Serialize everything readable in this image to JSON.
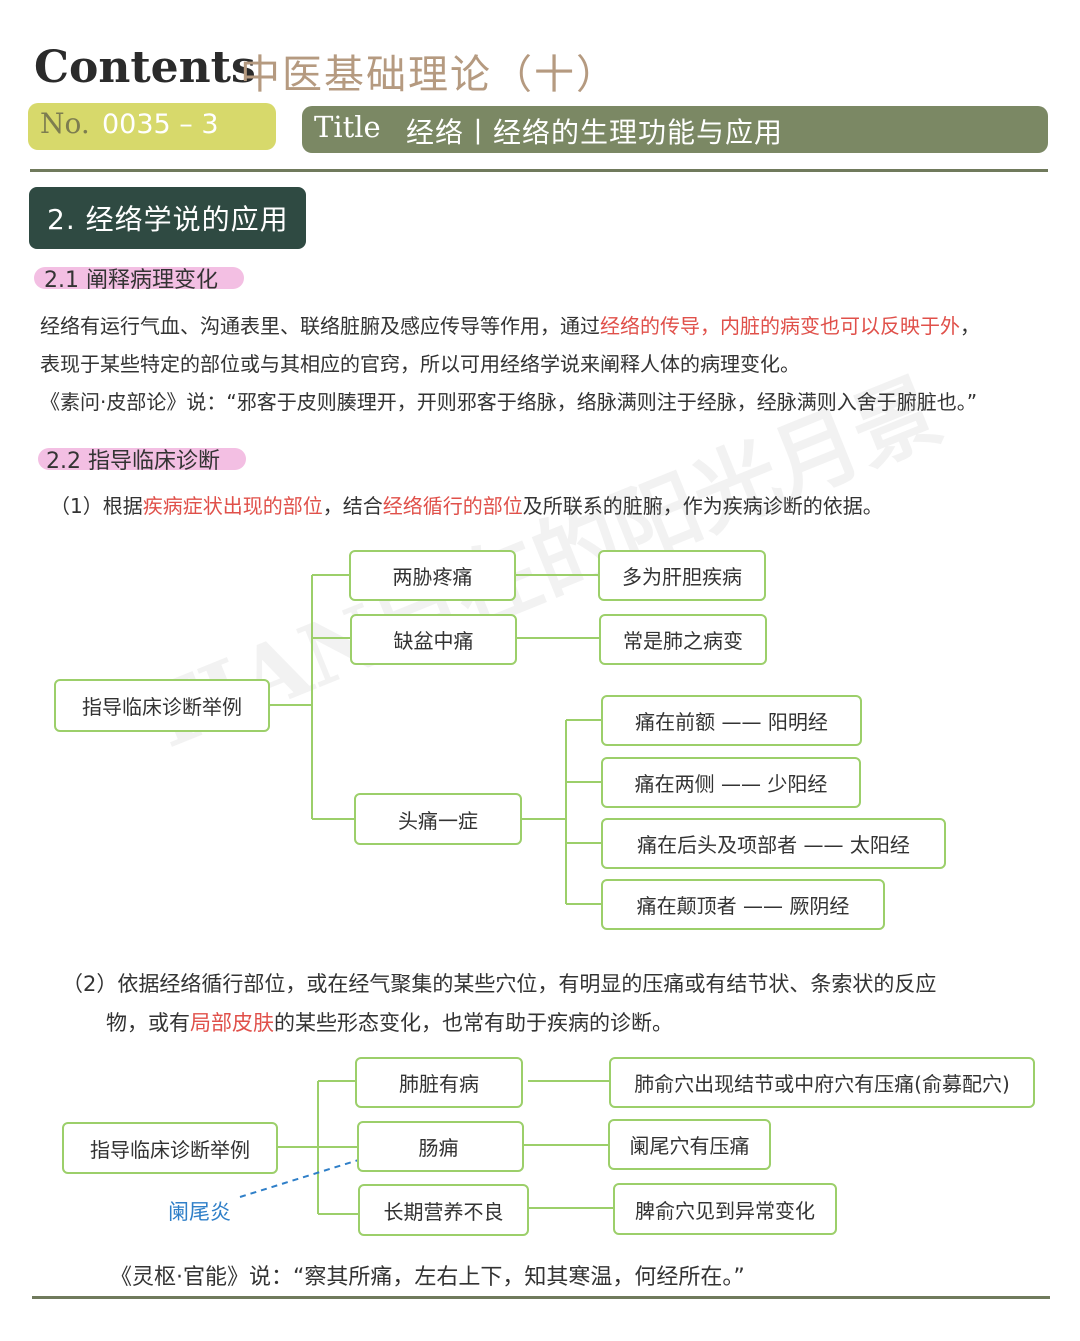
{
  "header": {
    "contents": "Contents",
    "subject": "中医基础理论（十）",
    "no_label": "No.",
    "no_value": "0035 – 3",
    "title_label": "Title",
    "title_text": "经络丨经络的生理功能与应用"
  },
  "section": {
    "title": "2.  经络学说的应用"
  },
  "sub1": {
    "title": "2.1  阐释病理变化",
    "line1_a": "经络有运行气血、沟通表里、联络脏腑及感应传导等作用，通过",
    "line1_red": "经络的传导，内脏的病变也可以反映于外",
    "line1_b": "，",
    "line2": "表现于某些特定的部位或与其相应的官窍，所以可用经络学说来阐释人体的病理变化。",
    "line3": "《素问·皮部论》说：“邪客于皮则腠理开，开则邪客于络脉，络脉满则注于经脉，经脉满则入舍于腑脏也。”"
  },
  "sub2": {
    "title": "2.2  指导临床诊断",
    "p1_a": "（1）根据",
    "p1_red1": "疾病症状出现的部位",
    "p1_b": "，结合",
    "p1_red2": "经络循行的部位",
    "p1_c": "及所联系的脏腑，作为疾病诊断的依据。",
    "p2_line1": "（2）依据经络循行部位，或在经气聚集的某些穴位，有明显的压痛或有结节状、条索状的反应",
    "p2_a": "物，或有",
    "p2_red": "局部皮肤",
    "p2_b": "的某些形态变化，也常有助于疾病的诊断。"
  },
  "diagram1": {
    "root": "指导临床诊断举例",
    "n1": "两胁疼痛",
    "r1": "多为肝胆疾病",
    "n2": "缺盆中痛",
    "r2": "常是肺之病变",
    "n3": "头痛一症",
    "h1": "痛在前额 —— 阳明经",
    "h2": "痛在两侧 —— 少阳经",
    "h3": "痛在后头及项部者 —— 太阳经",
    "h4": "痛在颠顶者 —— 厥阴经"
  },
  "diagram2": {
    "root": "指导临床诊断举例",
    "n1": "肺脏有病",
    "r1": "肺俞穴出现结节或中府穴有压痛(俞募配穴)",
    "n2": "肠痈",
    "r2": "阑尾穴有压痛",
    "n3": "长期营养不良",
    "r3": "脾俞穴见到异常变化",
    "annotation": "阑尾炎"
  },
  "quote2": "《灵枢·官能》说：“察其所痛，左右上下，知其寒温，何经所在。”",
  "watermark": "TIAN自在的阳光月景",
  "colors": {
    "node_border": "#9ccf6a",
    "accent_red": "#e0504a",
    "section_bg": "#2f4a42",
    "title_bar": "#7b8864",
    "no_bar": "#d7d96b",
    "highlight_pink": "#f3bfe3",
    "annotation_blue": "#2f7fc8"
  }
}
